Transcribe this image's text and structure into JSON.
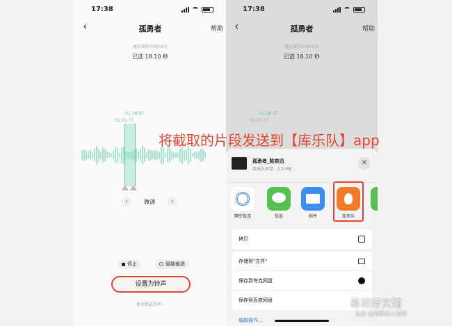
{
  "left_screen": {
    "status": {
      "time": "17:38"
    },
    "nav": {
      "back": "‹",
      "title": "孤勇者",
      "help": "帮助"
    },
    "hint": "建议裁剪30秒以内",
    "selected": "已选 18.10 秒",
    "time_top": "01:38.87",
    "time_left": "01:20.77",
    "finetune": {
      "prev": "‹",
      "label": "微调",
      "next": "›"
    },
    "stop_label": "停止",
    "smart_label": "智能裁选",
    "set_ringtone": "设置为铃声",
    "more": "更多精选铃声 ›"
  },
  "right_screen": {
    "status": {
      "time": "17:38"
    },
    "nav": {
      "back": "‹",
      "title": "孤勇者",
      "help": "帮助"
    },
    "hint": "建议裁剪30秒以内",
    "selected": "已选 18.10 秒",
    "time_top": "01:38.87",
    "time_left": "01:20.77",
    "sheet": {
      "file_name": "孤勇者_陈奕迅",
      "file_meta": "库乐队项目 · 2.9 MB",
      "close": "✕",
      "apps": [
        {
          "label": "隔空投送",
          "icon": "airdrop-icon"
        },
        {
          "label": "信息",
          "icon": "messages-icon"
        },
        {
          "label": "邮件",
          "icon": "mail-icon"
        },
        {
          "label": "库乐队",
          "icon": "garageband-icon"
        }
      ],
      "actions_group1": [
        "拷贝"
      ],
      "actions_group2": [
        "存储到\"文件\"",
        "保存到夸克网盘",
        "保存到百度网盘"
      ],
      "edit_actions": "编辑操作..."
    }
  },
  "caption": "将截取的片段发送到【库乐队】app",
  "watermark": {
    "main": "易坊好文馆",
    "sub": "头条 @数码达人软件"
  },
  "colors": {
    "accent_red": "#e0452f",
    "wave_green": "#6cc9a8"
  }
}
